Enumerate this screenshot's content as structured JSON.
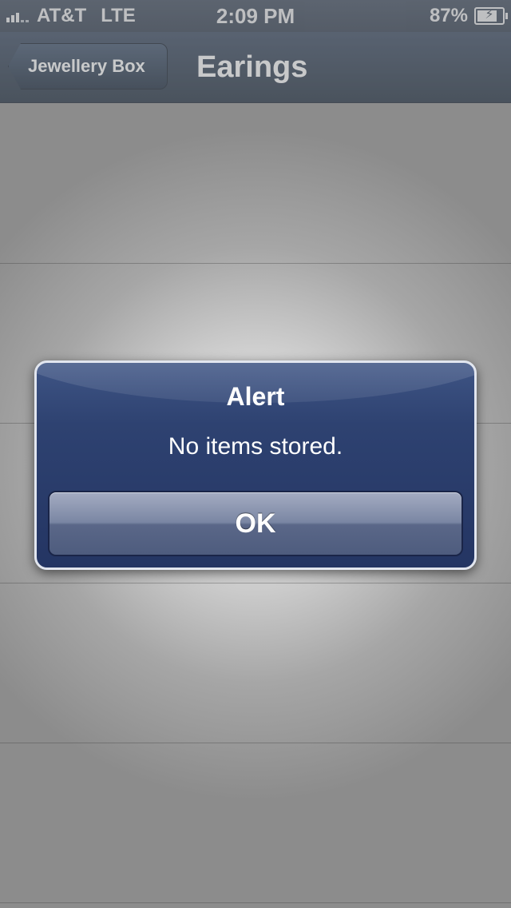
{
  "status_bar": {
    "carrier": "AT&T",
    "network": "LTE",
    "time": "2:09 PM",
    "battery_percent": "87%",
    "battery_level": 0.87,
    "signal_bars": 3
  },
  "nav_bar": {
    "back_label": "Jewellery Box",
    "title": "Earings"
  },
  "alert": {
    "title": "Alert",
    "message": "No items stored.",
    "button_label": "OK"
  },
  "colors": {
    "nav_bar": "#3c4a5c",
    "alert_background": "#2e4271",
    "alert_border": "#e2e6ef"
  }
}
